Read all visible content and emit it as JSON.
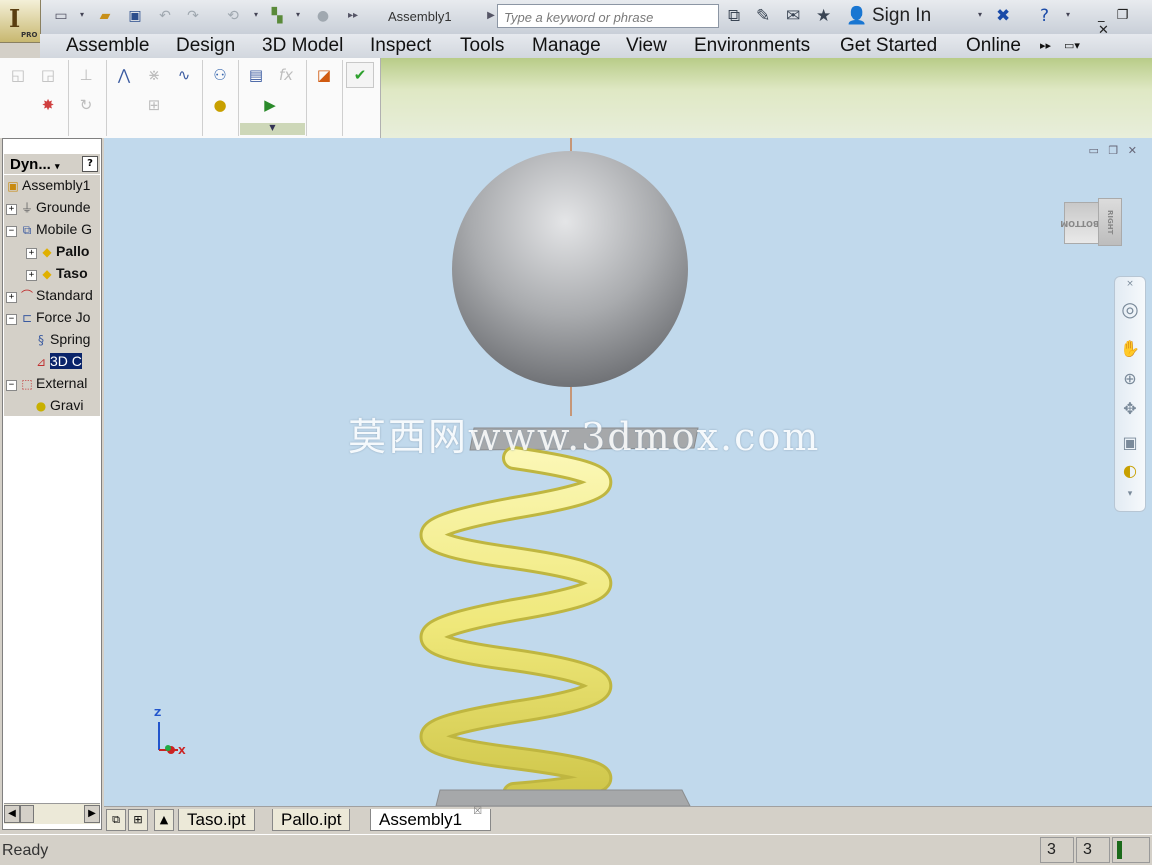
{
  "app": {
    "logo_text": "I",
    "edition": "PRO",
    "document_title": "Assembly1",
    "search": {
      "placeholder": "Type a keyword or phrase"
    },
    "sign_in": "Sign In"
  },
  "menu": [
    "Assemble",
    "Design",
    "3D Model",
    "Inspect",
    "Tools",
    "Manage",
    "View",
    "Environments",
    "Get Started",
    "Online"
  ],
  "ribbon": {
    "ok_icon": "check-icon"
  },
  "browser": {
    "title": "Dyn...",
    "help": "?",
    "tree": [
      {
        "label": "Assembly1",
        "icon": "assembly-icon"
      },
      {
        "label": "Grounde",
        "icon": "grounded-icon"
      },
      {
        "label": "Mobile G",
        "icon": "mobile-group-icon"
      },
      {
        "label": "Pallo",
        "icon": "part-icon"
      },
      {
        "label": "Taso",
        "icon": "part-icon"
      },
      {
        "label": "Standard",
        "icon": "standard-joint-icon"
      },
      {
        "label": "Force Jo",
        "icon": "force-joint-icon"
      },
      {
        "label": "Spring",
        "icon": "spring-icon"
      },
      {
        "label": "3D C",
        "icon": "3d-contact-icon"
      },
      {
        "label": "External",
        "icon": "external-load-icon"
      },
      {
        "label": "Gravi",
        "icon": "gravity-icon"
      }
    ]
  },
  "viewport": {
    "watermark": "莫西网www.3dmox.com",
    "viewcube": {
      "face": "BOTTOM",
      "side": "RIGHT"
    },
    "triad": {
      "z": "Z",
      "x": "X"
    }
  },
  "doc_tabs": [
    "Taso.ipt",
    "Pallo.ipt",
    "Assembly1"
  ],
  "doc_tab_active": "Assembly1",
  "status": {
    "text": "Ready",
    "count1": "3",
    "count2": "3"
  },
  "colors": {
    "spring": "#f0ea7a",
    "sphere": "#a9abae",
    "viewport_bg": "#c1d9ec"
  }
}
